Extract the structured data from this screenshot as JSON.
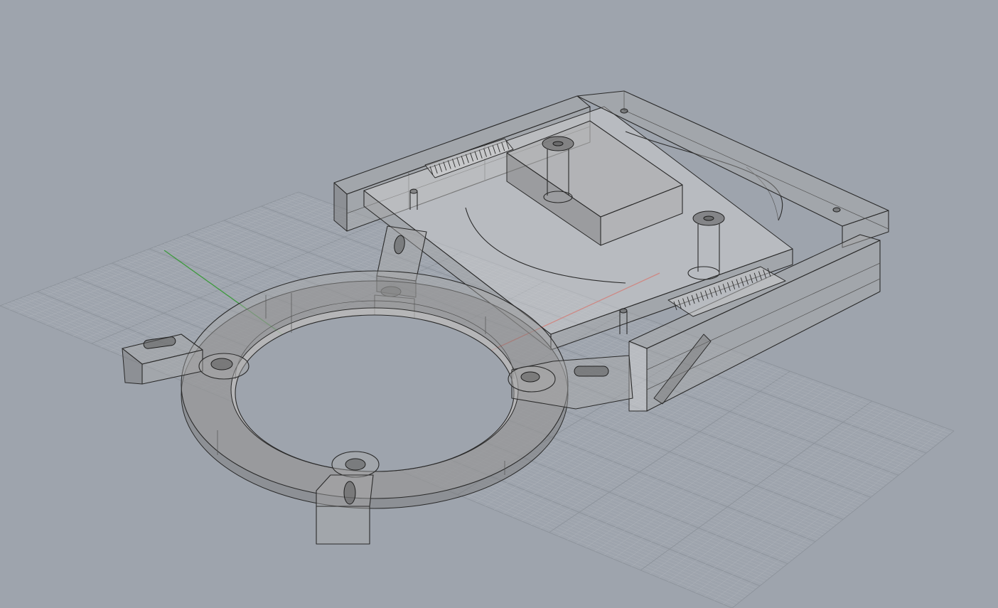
{
  "viewport": {
    "background": "#9ea4ad",
    "grid_minor_color": "#aeb3ba",
    "grid_major_color": "#8d939b",
    "x_axis_color": "#c8473f",
    "y_axis_color": "#3e9a3e"
  },
  "model": {
    "description_icon": "3d-model-icon",
    "parts": [
      "mount-ring",
      "carriage-frame",
      "clamp-tabs",
      "rails"
    ]
  }
}
